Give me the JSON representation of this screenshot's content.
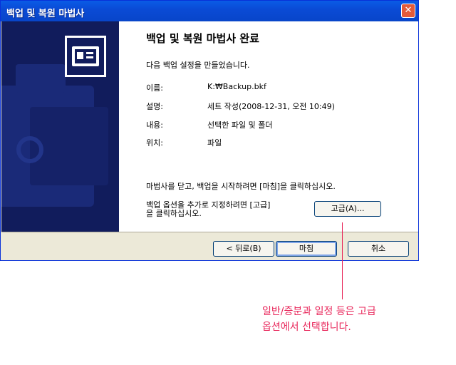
{
  "window": {
    "title": "백업 및 복원 마법사",
    "close_glyph": "✕"
  },
  "heading": "백업 및 복원 마법사 완료",
  "intro": "다음 백업 설정을 만들었습니다.",
  "settings": [
    {
      "label": "이름:",
      "value": "K:₩Backup.bkf"
    },
    {
      "label": "설명:",
      "value": "세트 작성(2008-12-31, 오전 10:49)"
    },
    {
      "label": "내용:",
      "value": "선택한 파일 및 폴더"
    },
    {
      "label": "위치:",
      "value": "파일"
    }
  ],
  "finish_hint": "마법사를 닫고, 백업을 시작하려면 [마침]을 클릭하십시오.",
  "advanced_hint": {
    "line1": "백업 옵션을 추가로 지정하려면 [고급]",
    "line2": "을 클릭하십시오."
  },
  "buttons": {
    "advanced": "고급(A)...",
    "back": "< 뒤로(B)",
    "finish": "마침",
    "cancel": "취소"
  },
  "callout": {
    "line1": "일반/증분과 일정 등은 고급",
    "line2": "옵션에서 선택합니다."
  },
  "colors": {
    "sidebar": "#111c5c",
    "callout": "#e8265a",
    "titlebar": "#0a4bd6"
  }
}
